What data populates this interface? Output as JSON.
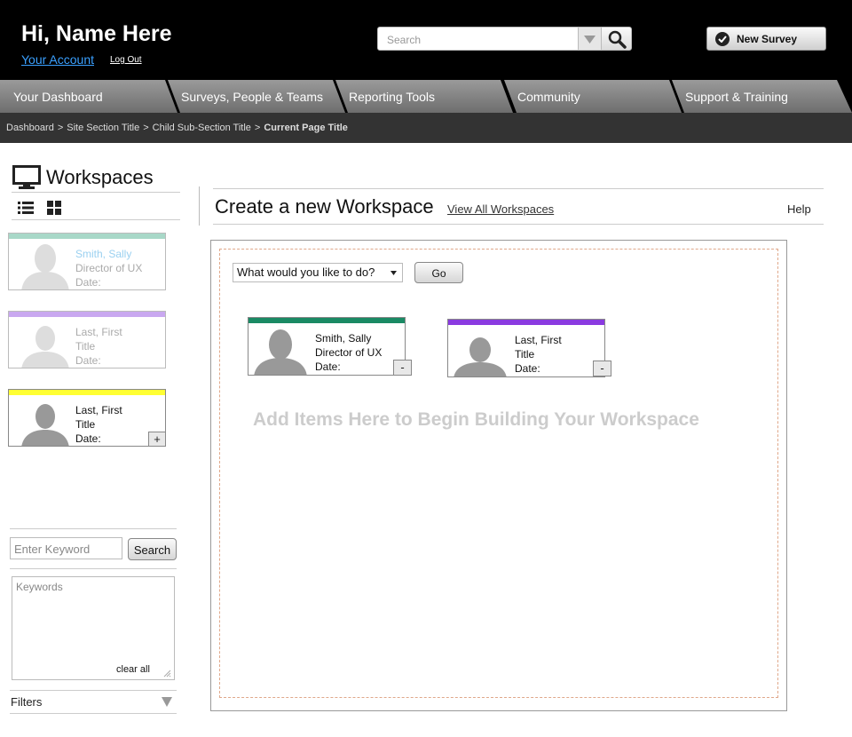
{
  "header": {
    "greeting": "Hi, Name Here",
    "account_link": "Your Account",
    "logout_link": "Log Out",
    "search_placeholder": "Search",
    "new_survey_label": "New Survey"
  },
  "nav": {
    "tabs": [
      {
        "label": "Your Dashboard"
      },
      {
        "label": "Surveys, People & Teams"
      },
      {
        "label": "Reporting Tools"
      },
      {
        "label": "Community"
      },
      {
        "label": "Support & Training"
      }
    ]
  },
  "breadcrumb": {
    "items": [
      "Dashboard",
      "Site Section Title",
      "Child Sub-Section Title"
    ],
    "separator": ">",
    "current": "Current Page Title"
  },
  "sidebar": {
    "title": "Workspaces",
    "cards": [
      {
        "name": "Smith, Sally",
        "title": "Director of UX",
        "date": "Date:",
        "color": "#a8d8c8",
        "state": "faded"
      },
      {
        "name": "Last, First",
        "title": "Title",
        "date": "Date:",
        "color": "#c9a8f0",
        "state": "faded"
      },
      {
        "name": "Last, First",
        "title": "Title",
        "date": "Date:",
        "color": "#ffff33",
        "state": "active",
        "add_label": "+"
      }
    ],
    "keyword_placeholder": "Enter Keyword",
    "search_button": "Search",
    "keywords_label": "Keywords",
    "clear_all": "clear all",
    "filters_label": "Filters"
  },
  "main": {
    "title": "Create a new Workspace",
    "view_all_link": "View All Workspaces",
    "help_link": "Help",
    "action_select": "What would you like to do?",
    "go_button": "Go",
    "cards": [
      {
        "name": "Smith, Sally",
        "title": "Director of UX",
        "date": "Date:",
        "color": "#1a8a64",
        "remove_label": "-"
      },
      {
        "name": "Last, First",
        "title": "Title",
        "date": "Date:",
        "color": "#8a3ae0",
        "remove_label": "-"
      }
    ],
    "placeholder": "Add Items Here to Begin Building Your Workspace"
  },
  "colors": {
    "header_bg": "#000000",
    "breadcrumb_bg": "#333333",
    "link": "#3aa0ff"
  }
}
